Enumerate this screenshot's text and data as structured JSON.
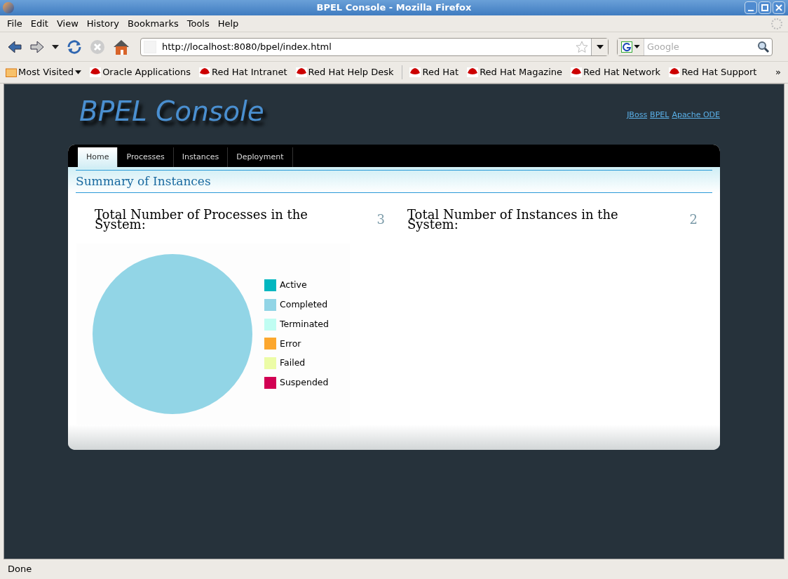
{
  "window": {
    "title": "BPEL Console - Mozilla Firefox"
  },
  "menu": [
    "File",
    "Edit",
    "View",
    "History",
    "Bookmarks",
    "Tools",
    "Help"
  ],
  "address": {
    "value": "http://localhost:8080/bpel/index.html"
  },
  "search": {
    "placeholder": "Google"
  },
  "bookmarks": [
    {
      "label": "Most Visited",
      "kind": "folder"
    },
    {
      "label": "Oracle Applications",
      "kind": "link"
    },
    {
      "label": "Red Hat Intranet",
      "kind": "link"
    },
    {
      "label": "Red Hat Help Desk",
      "kind": "link"
    },
    {
      "label": "Red Hat",
      "kind": "link"
    },
    {
      "label": "Red Hat Magazine",
      "kind": "link"
    },
    {
      "label": "Red Hat Network",
      "kind": "link"
    },
    {
      "label": "Red Hat Support",
      "kind": "link"
    }
  ],
  "bookmarks_overflow": "»",
  "page": {
    "logo": "BPEL Console",
    "links": [
      "JBoss",
      "BPEL",
      "Apache ODE"
    ],
    "tabs": [
      {
        "label": "Home",
        "selected": true
      },
      {
        "label": "Processes",
        "selected": false
      },
      {
        "label": "Instances",
        "selected": false
      },
      {
        "label": "Deployment",
        "selected": false
      }
    ],
    "section_title": "Summary of Instances",
    "stats": [
      {
        "label": "Total Number of Processes in the System:",
        "value": "3"
      },
      {
        "label": "Total Number of Instances in the System:",
        "value": "2"
      }
    ],
    "chart_data": {
      "type": "pie",
      "categories": [
        "Active",
        "Completed",
        "Terminated",
        "Error",
        "Failed",
        "Suspended"
      ],
      "values": [
        0,
        1,
        0,
        0,
        0,
        0
      ],
      "colors": [
        "#00b7c0",
        "#92d5e6",
        "#c0fdf2",
        "#fca72e",
        "#ecfca6",
        "#d20053"
      ]
    }
  },
  "status_bar": "Done"
}
